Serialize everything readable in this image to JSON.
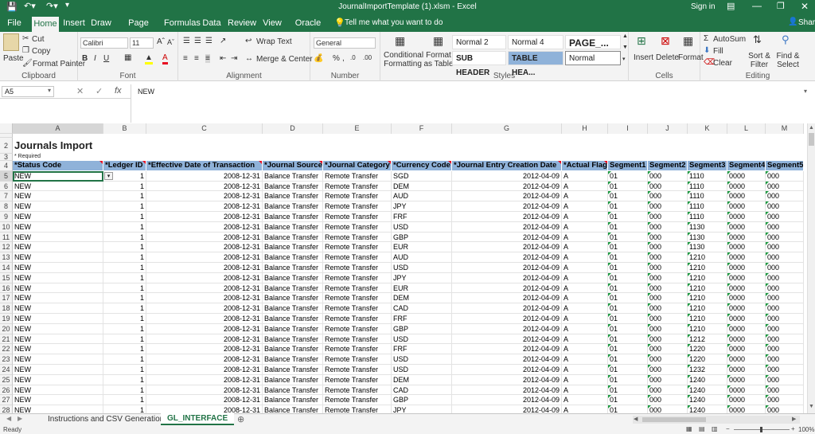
{
  "window": {
    "title": "JournalImportTemplate (1).xlsm  -  Excel",
    "sign_in": "Sign in",
    "share": "Share"
  },
  "tabs": [
    "File",
    "Home",
    "Insert",
    "Draw",
    "Page Layout",
    "Formulas",
    "Data",
    "Review",
    "View",
    "Oracle ADF"
  ],
  "tell_me": "Tell me what you want to do",
  "ribbon": {
    "clipboard": {
      "label": "Clipboard",
      "paste": "Paste",
      "cut": "Cut",
      "copy": "Copy",
      "format_painter": "Format Painter"
    },
    "font": {
      "label": "Font",
      "name": "Calibri",
      "size": "11"
    },
    "alignment": {
      "label": "Alignment",
      "wrap": "Wrap Text",
      "merge": "Merge & Center"
    },
    "number": {
      "label": "Number",
      "format": "General"
    },
    "styles": {
      "label": "Styles",
      "cond": "Conditional Formatting",
      "fmt_table": "Format as Table",
      "normal2": "Normal 2",
      "normal4": "Normal 4",
      "page": "PAGE_...",
      "sub_header": "SUB HEADER",
      "table_hea": "TABLE HEA...",
      "normal": "Normal"
    },
    "cells": {
      "label": "Cells",
      "insert": "Insert",
      "delete": "Delete",
      "format": "Format"
    },
    "editing": {
      "label": "Editing",
      "autosum": "AutoSum",
      "fill": "Fill",
      "clear": "Clear",
      "sort": "Sort & Filter",
      "find": "Find & Select"
    }
  },
  "formula_bar": {
    "name_box": "A5",
    "value": "NEW",
    "fx": "fx"
  },
  "columns": [
    "A",
    "B",
    "C",
    "D",
    "E",
    "F",
    "G",
    "H",
    "I",
    "J",
    "K",
    "L",
    "M"
  ],
  "sheet": {
    "title": "Journals Import",
    "required_note": "* Required",
    "headers": [
      "*Status Code",
      "*Ledger ID",
      "*Effective Date of Transaction",
      "*Journal Source",
      "*Journal Category",
      "*Currency Code",
      "*Journal Entry Creation Date",
      "*Actual Flag",
      "Segment1",
      "Segment2",
      "Segment3",
      "Segment4",
      "Segment5"
    ],
    "rows": [
      {
        "n": "5",
        "cur": "SGD",
        "s3": "1110"
      },
      {
        "n": "6",
        "cur": "DEM",
        "s3": "1110"
      },
      {
        "n": "7",
        "cur": "AUD",
        "s3": "1110"
      },
      {
        "n": "8",
        "cur": "JPY",
        "s3": "1110"
      },
      {
        "n": "9",
        "cur": "FRF",
        "s3": "1110"
      },
      {
        "n": "10",
        "cur": "USD",
        "s3": "1130"
      },
      {
        "n": "11",
        "cur": "GBP",
        "s3": "1130"
      },
      {
        "n": "12",
        "cur": "EUR",
        "s3": "1130"
      },
      {
        "n": "13",
        "cur": "AUD",
        "s3": "1210"
      },
      {
        "n": "14",
        "cur": "USD",
        "s3": "1210"
      },
      {
        "n": "15",
        "cur": "JPY",
        "s3": "1210"
      },
      {
        "n": "16",
        "cur": "EUR",
        "s3": "1210"
      },
      {
        "n": "17",
        "cur": "DEM",
        "s3": "1210"
      },
      {
        "n": "18",
        "cur": "CAD",
        "s3": "1210"
      },
      {
        "n": "19",
        "cur": "FRF",
        "s3": "1210"
      },
      {
        "n": "20",
        "cur": "GBP",
        "s3": "1210"
      },
      {
        "n": "21",
        "cur": "USD",
        "s3": "1212"
      },
      {
        "n": "22",
        "cur": "FRF",
        "s3": "1220"
      },
      {
        "n": "23",
        "cur": "USD",
        "s3": "1220"
      },
      {
        "n": "24",
        "cur": "USD",
        "s3": "1232"
      },
      {
        "n": "25",
        "cur": "DEM",
        "s3": "1240"
      },
      {
        "n": "26",
        "cur": "CAD",
        "s3": "1240"
      },
      {
        "n": "27",
        "cur": "GBP",
        "s3": "1240"
      },
      {
        "n": "28",
        "cur": "JPY",
        "s3": "1240"
      }
    ],
    "common": {
      "status": "NEW",
      "ledger": "1",
      "eff_date": "2008-12-31",
      "source": "Balance Transfer",
      "category": "Remote Transfer",
      "created": "2012-04-09",
      "flag": "A",
      "s1": "01",
      "s2": "000",
      "s4": "0000",
      "s5": "000"
    }
  },
  "sheet_tabs": [
    "Instructions and CSV Generation",
    "GL_INTERFACE"
  ],
  "status": {
    "ready": "Ready",
    "zoom": "100%"
  }
}
